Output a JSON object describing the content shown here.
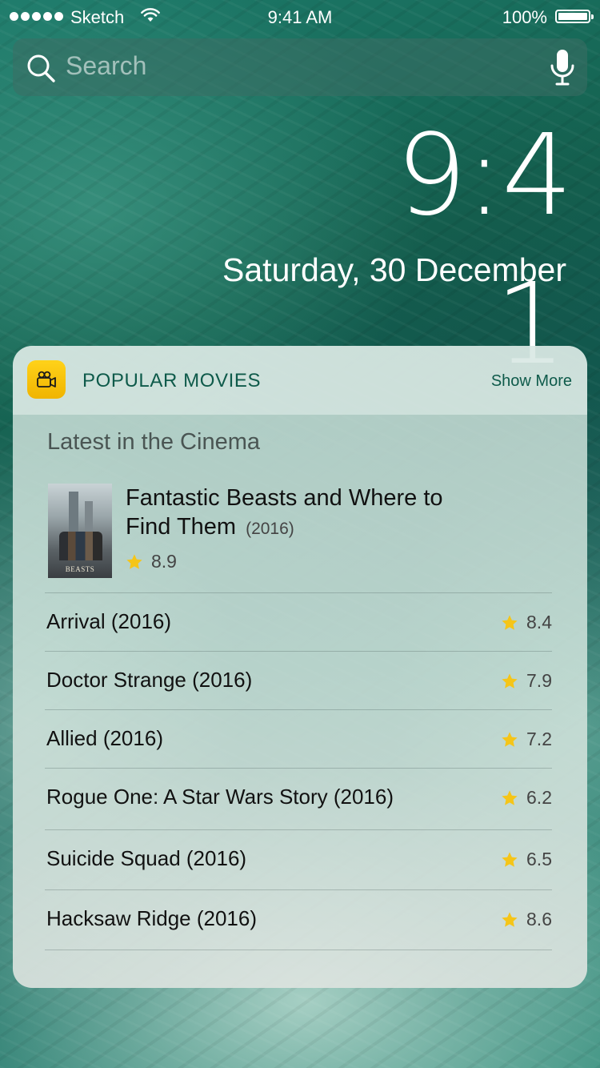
{
  "status_bar": {
    "carrier": "Sketch",
    "time": "9:41 AM",
    "battery": "100%",
    "battery_level": 1.0
  },
  "search": {
    "placeholder": "Search"
  },
  "lock_screen": {
    "time_main": "9:4",
    "time_overflow": "1",
    "date": "Saturday, 30 December"
  },
  "widget": {
    "title": "POPULAR MOVIES",
    "show_more": "Show More",
    "section_title": "Latest in the Cinema",
    "featured": {
      "title": "Fantastic Beasts and Where to Find Them",
      "year": "(2016)",
      "rating": "8.9",
      "poster_caption": "BEASTS"
    },
    "movies": [
      {
        "title": "Arrival (2016)",
        "rating": "8.4"
      },
      {
        "title": "Doctor Strange (2016)",
        "rating": "7.9"
      },
      {
        "title": "Allied (2016)",
        "rating": "7.2"
      },
      {
        "title": "Rogue One: A Star Wars Story (2016)",
        "rating": "6.2"
      },
      {
        "title": "Suicide Squad (2016)",
        "rating": "6.5"
      },
      {
        "title": "Hacksaw Ridge (2016)",
        "rating": "8.6"
      }
    ]
  },
  "colors": {
    "accent_green": "#0e5a4a",
    "star_yellow": "#f5c518",
    "app_icon_yellow": "#ffd21a"
  },
  "icons": {
    "search": "search-icon",
    "mic": "microphone-icon",
    "wifi": "wifi-icon",
    "battery": "battery-icon",
    "app": "movie-camera-icon",
    "star": "star-icon"
  }
}
